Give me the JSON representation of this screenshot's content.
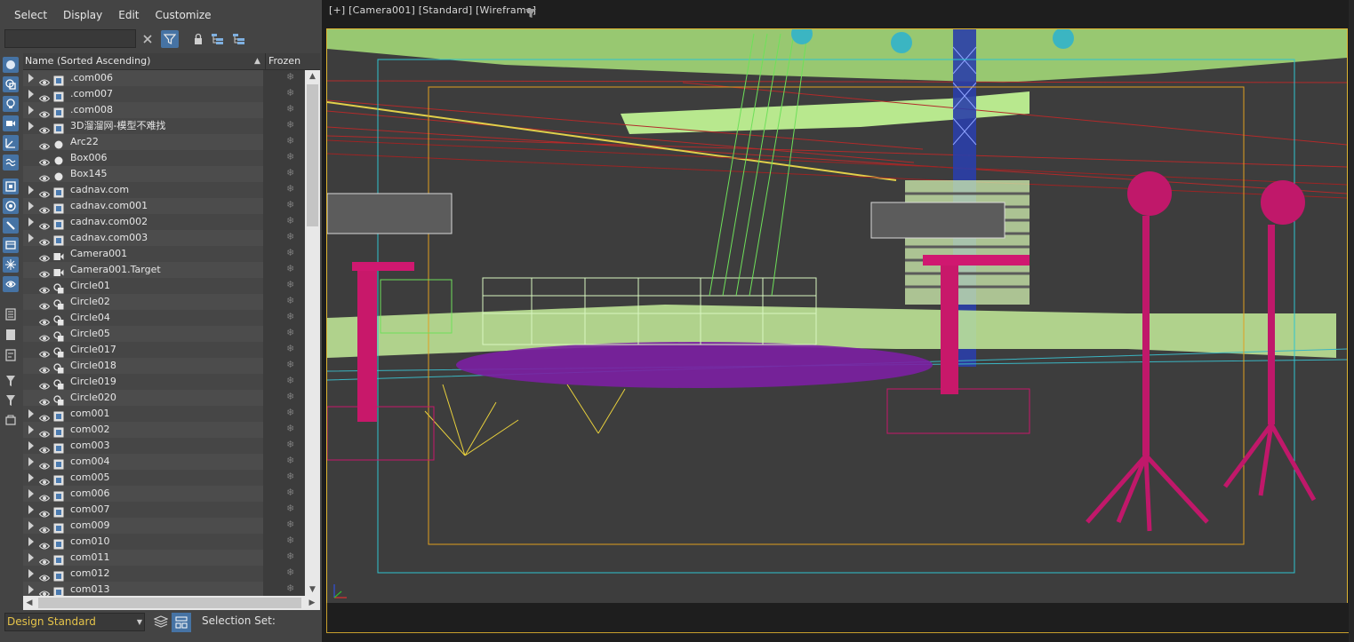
{
  "menu": [
    "Select",
    "Display",
    "Edit",
    "Customize"
  ],
  "search": {
    "value": ""
  },
  "columns": {
    "name": "Name (Sorted Ascending)",
    "frozen": "Frozen"
  },
  "tree": [
    {
      "label": ".com006",
      "type": "group",
      "expandable": true
    },
    {
      "label": ".com007",
      "type": "group",
      "expandable": true
    },
    {
      "label": ".com008",
      "type": "group",
      "expandable": true
    },
    {
      "label": "3D溜溜网-模型不难找",
      "type": "group",
      "expandable": true
    },
    {
      "label": "Arc22",
      "type": "shape",
      "expandable": false
    },
    {
      "label": "Box006",
      "type": "shape",
      "expandable": false
    },
    {
      "label": "Box145",
      "type": "shape",
      "expandable": false
    },
    {
      "label": "cadnav.com",
      "type": "group",
      "expandable": true
    },
    {
      "label": "cadnav.com001",
      "type": "group",
      "expandable": true
    },
    {
      "label": "cadnav.com002",
      "type": "group",
      "expandable": true
    },
    {
      "label": "cadnav.com003",
      "type": "group",
      "expandable": true
    },
    {
      "label": "Camera001",
      "type": "camera",
      "expandable": false
    },
    {
      "label": "Camera001.Target",
      "type": "camera",
      "expandable": false
    },
    {
      "label": "Circle01",
      "type": "circle",
      "expandable": false
    },
    {
      "label": "Circle02",
      "type": "circle",
      "expandable": false
    },
    {
      "label": "Circle04",
      "type": "circle",
      "expandable": false
    },
    {
      "label": "Circle05",
      "type": "circle",
      "expandable": false
    },
    {
      "label": "Circle017",
      "type": "circle",
      "expandable": false
    },
    {
      "label": "Circle018",
      "type": "circle",
      "expandable": false
    },
    {
      "label": "Circle019",
      "type": "circle",
      "expandable": false
    },
    {
      "label": "Circle020",
      "type": "circle",
      "expandable": false
    },
    {
      "label": "com001",
      "type": "group",
      "expandable": true
    },
    {
      "label": "com002",
      "type": "group",
      "expandable": true
    },
    {
      "label": "com003",
      "type": "group",
      "expandable": true
    },
    {
      "label": "com004",
      "type": "group",
      "expandable": true
    },
    {
      "label": "com005",
      "type": "group",
      "expandable": true
    },
    {
      "label": "com006",
      "type": "group",
      "expandable": true
    },
    {
      "label": "com007",
      "type": "group",
      "expandable": true
    },
    {
      "label": "com009",
      "type": "group",
      "expandable": true
    },
    {
      "label": "com010",
      "type": "group",
      "expandable": true
    },
    {
      "label": "com011",
      "type": "group",
      "expandable": true
    },
    {
      "label": "com012",
      "type": "group",
      "expandable": true
    },
    {
      "label": "com013",
      "type": "group",
      "expandable": true
    }
  ],
  "bottom": {
    "layer": "Design Standard",
    "selection_set_label": "Selection Set:"
  },
  "viewport": {
    "label": "[+] [Camera001] [Standard] [Wireframe]"
  },
  "colors": {
    "accent_blue": "#4673a4",
    "viewport_border": "#e0b632",
    "layer_text": "#e5c34a"
  }
}
